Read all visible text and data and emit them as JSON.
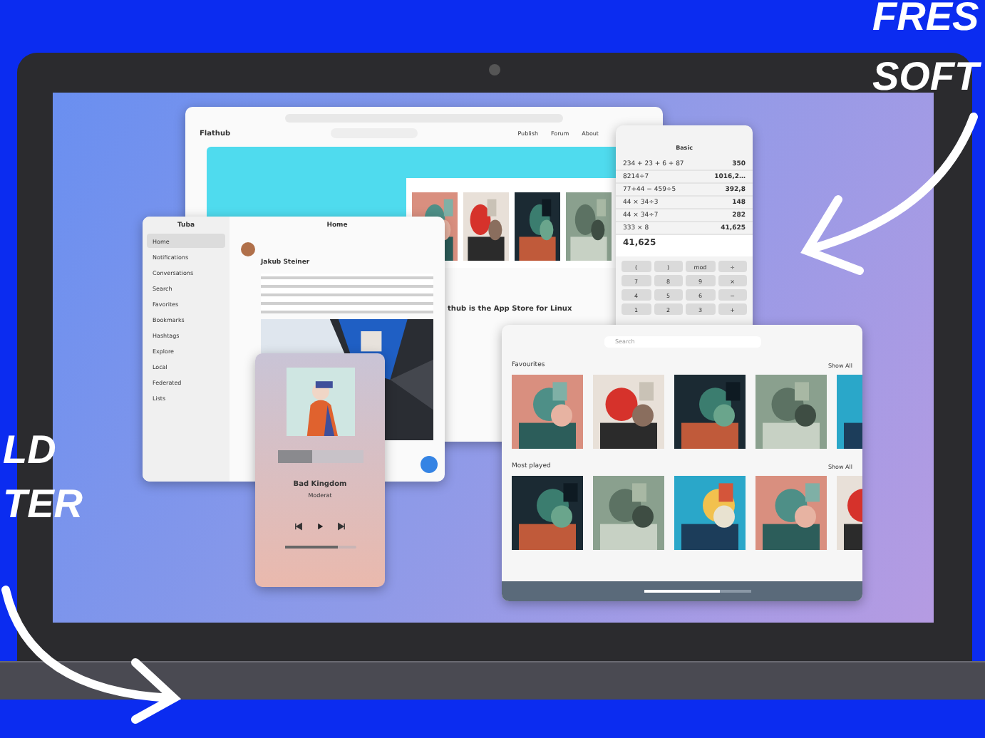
{
  "annotations": [
    {
      "text": "FRES"
    },
    {
      "text": "SOFT"
    },
    {
      "text": "LD"
    },
    {
      "text": "TER"
    }
  ],
  "browser": {
    "brand": "Flathub",
    "nav": [
      "Publish",
      "Forum",
      "About"
    ],
    "hero_title": "thub is the App Store for Linux"
  },
  "calculator": {
    "mode": "Basic",
    "history": [
      {
        "expr": "234 + 23 + 6 + 87",
        "result": "350"
      },
      {
        "expr": "8214÷7",
        "result": "1016,2…"
      },
      {
        "expr": "77+44 − 459÷5",
        "result": "392,8"
      },
      {
        "expr": "44 × 34÷3",
        "result": "148"
      },
      {
        "expr": "44 × 34÷7",
        "result": "282"
      },
      {
        "expr": "333 × 8",
        "result": "41,625"
      }
    ],
    "display": "41,625",
    "keys": [
      "(",
      ")",
      "mod",
      "÷",
      "7",
      "8",
      "9",
      "×",
      "4",
      "5",
      "6",
      "−",
      "1",
      "2",
      "3",
      "+"
    ]
  },
  "tuba": {
    "title": "Tuba",
    "header": "Home",
    "sidebar": [
      {
        "label": "Home",
        "selected": true
      },
      {
        "label": "Notifications",
        "selected": false
      },
      {
        "label": "Conversations",
        "selected": false
      },
      {
        "label": "Search",
        "selected": false
      },
      {
        "label": "Favorites",
        "selected": false
      },
      {
        "label": "Bookmarks",
        "selected": false
      },
      {
        "label": "Hashtags",
        "selected": false
      },
      {
        "label": "Explore",
        "selected": false
      },
      {
        "label": "Local",
        "selected": false
      },
      {
        "label": "Federated",
        "selected": false
      },
      {
        "label": "Lists",
        "selected": false
      }
    ],
    "post": {
      "author": "Jakub Steiner"
    }
  },
  "player": {
    "waveform": {
      "level": 0.4
    },
    "title": "Bad Kingdom",
    "artist": "Moderat",
    "seek": {
      "level": 0.75
    }
  },
  "music": {
    "search": {
      "placeholder": "Search"
    },
    "sections": [
      {
        "title": "Favourites",
        "action": "Show All"
      },
      {
        "title": "Most played",
        "action": "Show All"
      }
    ],
    "seek": {
      "level": 0.7
    }
  }
}
